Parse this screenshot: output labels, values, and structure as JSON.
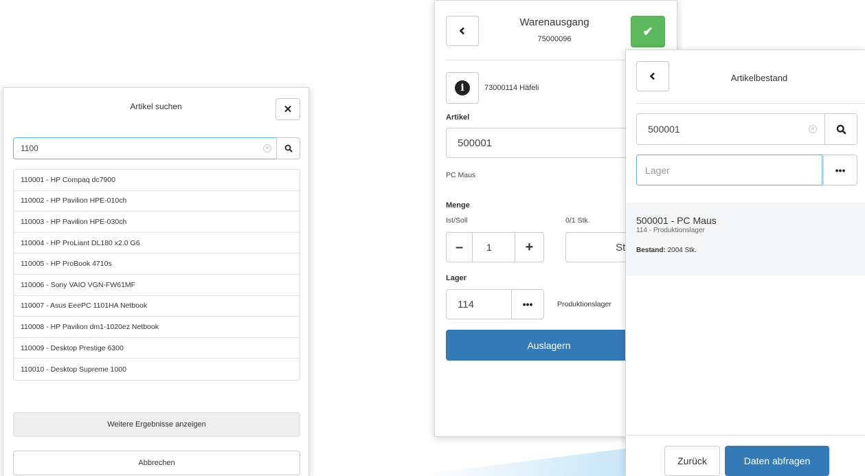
{
  "search_dialog": {
    "title": "Artikel suchen",
    "close_icon": "close-icon",
    "search": {
      "value": "1100",
      "clear_icon": "clear-icon",
      "search_icon": "search-icon"
    },
    "results": [
      "110001 - HP Compaq dc7900",
      "110002 - HP Pavilion HPE-010ch",
      "110003 - HP Pavilion HPE-030ch",
      "110004 - HP ProLiant DL180 x2.0 G6",
      "110005 - HP ProBook 4710s",
      "110006 - Sony VAIO VGN-FW61MF",
      "110007 - Asus EeePC 1101HA Netbook",
      "110008 - HP Pavilion dm1-1020ez Netbook",
      "110009 - Desktop Prestige 6300",
      "110010 - Desktop Supreme 1000"
    ],
    "more_label": "Weitere Ergebnisse anzeigen",
    "cancel_label": "Abbrechen"
  },
  "warenausgang": {
    "title": "Warenausgang",
    "document_no": "75000096",
    "back_icon": "chevron-left-icon",
    "confirm_icon": "check-icon",
    "info_icon": "info-icon",
    "customer": "73000114 Häfeli",
    "artikel_label": "Artikel",
    "artikel_value": "500001",
    "artikel_name": "PC Maus",
    "menge_label": "Menge",
    "ist_soll_label": "Ist/Soll",
    "ist_soll_value": "0/1 Stk.",
    "quantity_minus": "–",
    "quantity": "1",
    "quantity_plus": "+",
    "unit": "Stk.",
    "lager_label": "Lager",
    "lager_value": "114",
    "lager_browse": "•••",
    "lager_name": "Produktionslager",
    "submit_label": "Auslagern"
  },
  "artikelbestand": {
    "title": "Artikelbestand",
    "back_icon": "chevron-left-icon",
    "search_value": "500001",
    "clear_icon": "clear-icon",
    "search_icon": "search-icon",
    "lager_placeholder": "Lager",
    "lager_browse": "•••",
    "result": {
      "title": "500001 - PC Maus",
      "location": "114 - Produktionslager",
      "stock_label": "Bestand:",
      "stock_value": "2004 Stk."
    },
    "back_label": "Zurück",
    "query_label": "Daten abfragen"
  },
  "colors": {
    "primary": "#337ab7",
    "success": "#5cb85c",
    "focus": "#66afe9",
    "accent_wedge": "#cde9f8"
  }
}
